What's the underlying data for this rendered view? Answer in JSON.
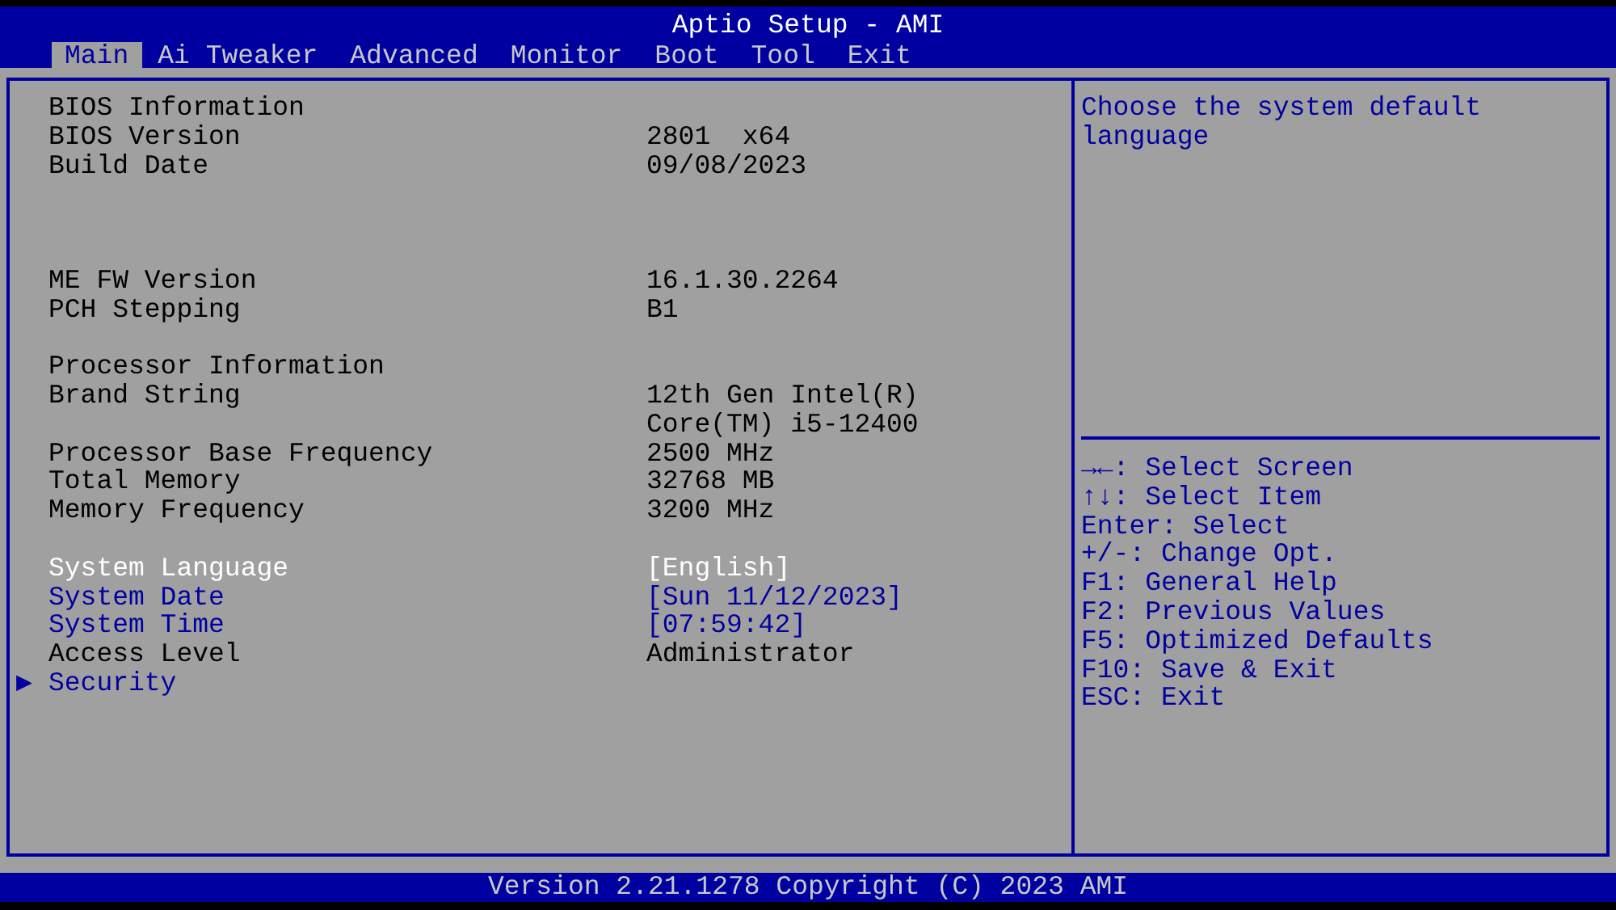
{
  "window": {
    "title": "Aptio Setup - AMI"
  },
  "tabs": [
    {
      "label": "Main",
      "selected": true
    },
    {
      "label": "Ai Tweaker",
      "selected": false
    },
    {
      "label": "Advanced",
      "selected": false
    },
    {
      "label": "Monitor",
      "selected": false
    },
    {
      "label": "Boot",
      "selected": false
    },
    {
      "label": "Tool",
      "selected": false
    },
    {
      "label": "Exit",
      "selected": false
    }
  ],
  "rows": [
    {
      "kind": "header",
      "label": "BIOS Information"
    },
    {
      "kind": "info",
      "label": "BIOS Version",
      "value": "2801  x64"
    },
    {
      "kind": "info",
      "label": "Build Date",
      "value": "09/08/2023"
    },
    {
      "kind": "blank"
    },
    {
      "kind": "blank"
    },
    {
      "kind": "blank"
    },
    {
      "kind": "info",
      "label": "ME FW Version",
      "value": "16.1.30.2264"
    },
    {
      "kind": "info",
      "label": "PCH Stepping",
      "value": "B1"
    },
    {
      "kind": "blank"
    },
    {
      "kind": "header",
      "label": "Processor Information"
    },
    {
      "kind": "info",
      "label": "Brand String",
      "value": "12th Gen Intel(R)"
    },
    {
      "kind": "info",
      "value": "Core(TM) i5-12400"
    },
    {
      "kind": "info",
      "label": "Processor Base Frequency",
      "value": "2500 MHz"
    },
    {
      "kind": "info",
      "label": "Total Memory",
      "value": "32768 MB"
    },
    {
      "kind": "info",
      "label": "Memory Frequency",
      "value": "3200 MHz"
    },
    {
      "kind": "blank"
    },
    {
      "kind": "setting",
      "label": "System Language",
      "value": "[English]",
      "selected": true
    },
    {
      "kind": "setting",
      "label": "System Date",
      "value": "[Sun 11/12/2023]",
      "selected": false
    },
    {
      "kind": "setting",
      "label": "System Time",
      "value": "[07:59:42]",
      "selected": false
    },
    {
      "kind": "info",
      "label": "Access Level",
      "value": "Administrator"
    },
    {
      "kind": "submenu",
      "marker": "▶",
      "label": "Security",
      "selected": false
    }
  ],
  "help": {
    "text": "Choose the system default language"
  },
  "keys": [
    "→←: Select Screen",
    "↑↓: Select Item",
    "Enter: Select",
    "+/-: Change Opt.",
    "F1: General Help",
    "F2: Previous Values",
    "F5: Optimized Defaults",
    "F10: Save & Exit",
    "ESC: Exit"
  ],
  "status_bar": "Version 2.21.1278 Copyright (C) 2023 AMI"
}
